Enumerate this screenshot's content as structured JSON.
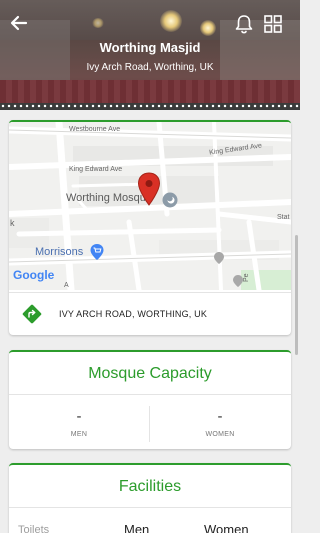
{
  "header": {
    "title": "Worthing Masjid",
    "subtitle": "Ivy Arch Road, Worthing, UK",
    "back_icon": "arrow-left-icon",
    "notification_icon": "bell-icon",
    "menu_icon": "grid-icon"
  },
  "map": {
    "streets": [
      "Westbourne Ave",
      "King Edward Ave",
      "King Edward Ave",
      "Stat",
      "Pe",
      "k",
      "A"
    ],
    "place_label": "Worthing Mosque",
    "poi_label": "Morrisons",
    "logo_text": "Google"
  },
  "address": {
    "text": "IVY ARCH ROAD, WORTHING, UK",
    "icon": "directions-icon"
  },
  "capacity": {
    "title": "Mosque Capacity",
    "men_value": "-",
    "men_label": "MEN",
    "women_value": "-",
    "women_label": "WOMEN"
  },
  "facilities": {
    "title": "Facilities",
    "columns": [
      "Toilets",
      "Men",
      "Women"
    ]
  },
  "colors": {
    "accent": "#2c9c2c",
    "pin": "#d93025",
    "poi": "#4285f4"
  }
}
